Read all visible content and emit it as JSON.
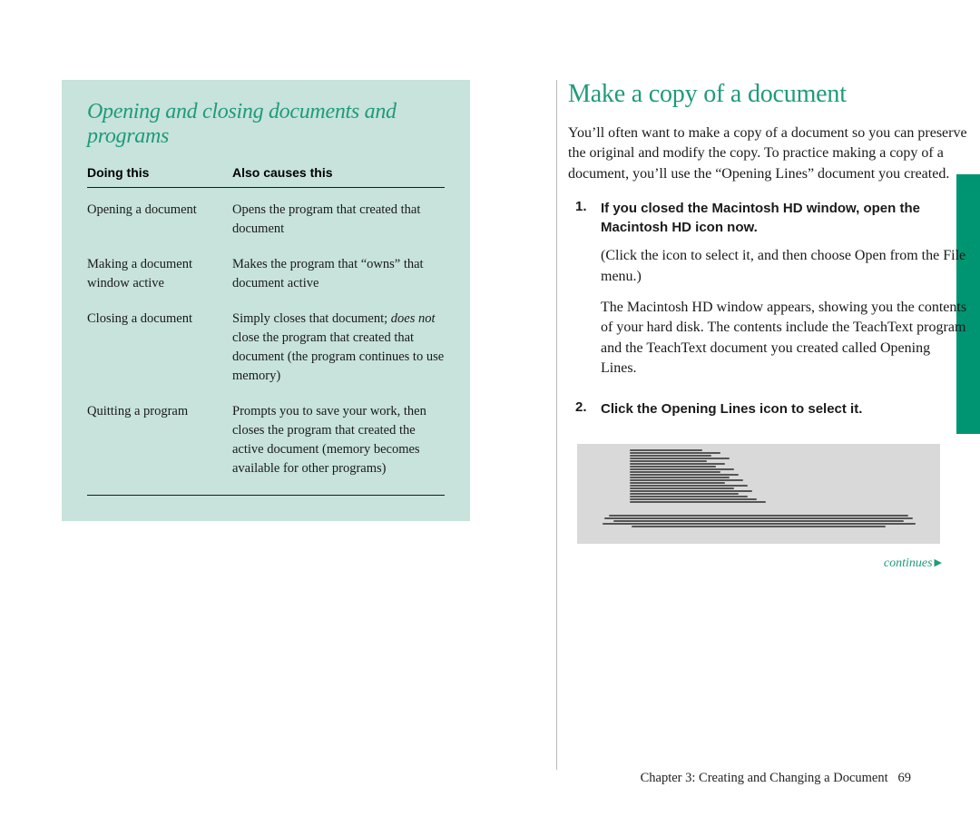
{
  "colors": {
    "teal": "#1f9a7b",
    "tab": "#009572",
    "sidebar_bg": "#c7e3db"
  },
  "left": {
    "title": "Opening and closing documents and programs",
    "headers": {
      "col1": "Doing this",
      "col2": "Also causes this"
    },
    "rows": [
      {
        "doing": "Opening a document",
        "causes": "Opens the program that created that document"
      },
      {
        "doing": "Making a document window active",
        "causes": "Makes the program that “owns” that document active"
      },
      {
        "doing": "Closing a document",
        "causes_pre": "Simply closes that document; ",
        "causes_em": "does not",
        "causes_post": " close the program that created that document (the program continues to use memory)"
      },
      {
        "doing": "Quitting a program",
        "causes": "Prompts you to save your work, then closes the program that created the active document (memory becomes available for other programs)"
      }
    ]
  },
  "right": {
    "title": "Make a copy of a document",
    "intro": "You’ll often want to make a copy of a document so you can preserve the original and modify the copy. To practice making a copy of a document, you’ll use the “Opening Lines” document you created.",
    "steps": [
      {
        "num": "1.",
        "title": "If you closed the Macintosh HD window, open the Macintosh HD icon now.",
        "paras": [
          "(Click the icon to select it, and then choose Open from the File menu.)",
          "The Macintosh HD window appears, showing you the contents of your hard disk. The contents include the TeachText program and the TeachText document you created called Opening Lines."
        ]
      },
      {
        "num": "2.",
        "title": "Click the Opening Lines icon to select it.",
        "paras": []
      }
    ],
    "continues": "continues"
  },
  "footer": {
    "chapter": "Chapter 3: Creating and Changing a Document",
    "page": "69"
  }
}
